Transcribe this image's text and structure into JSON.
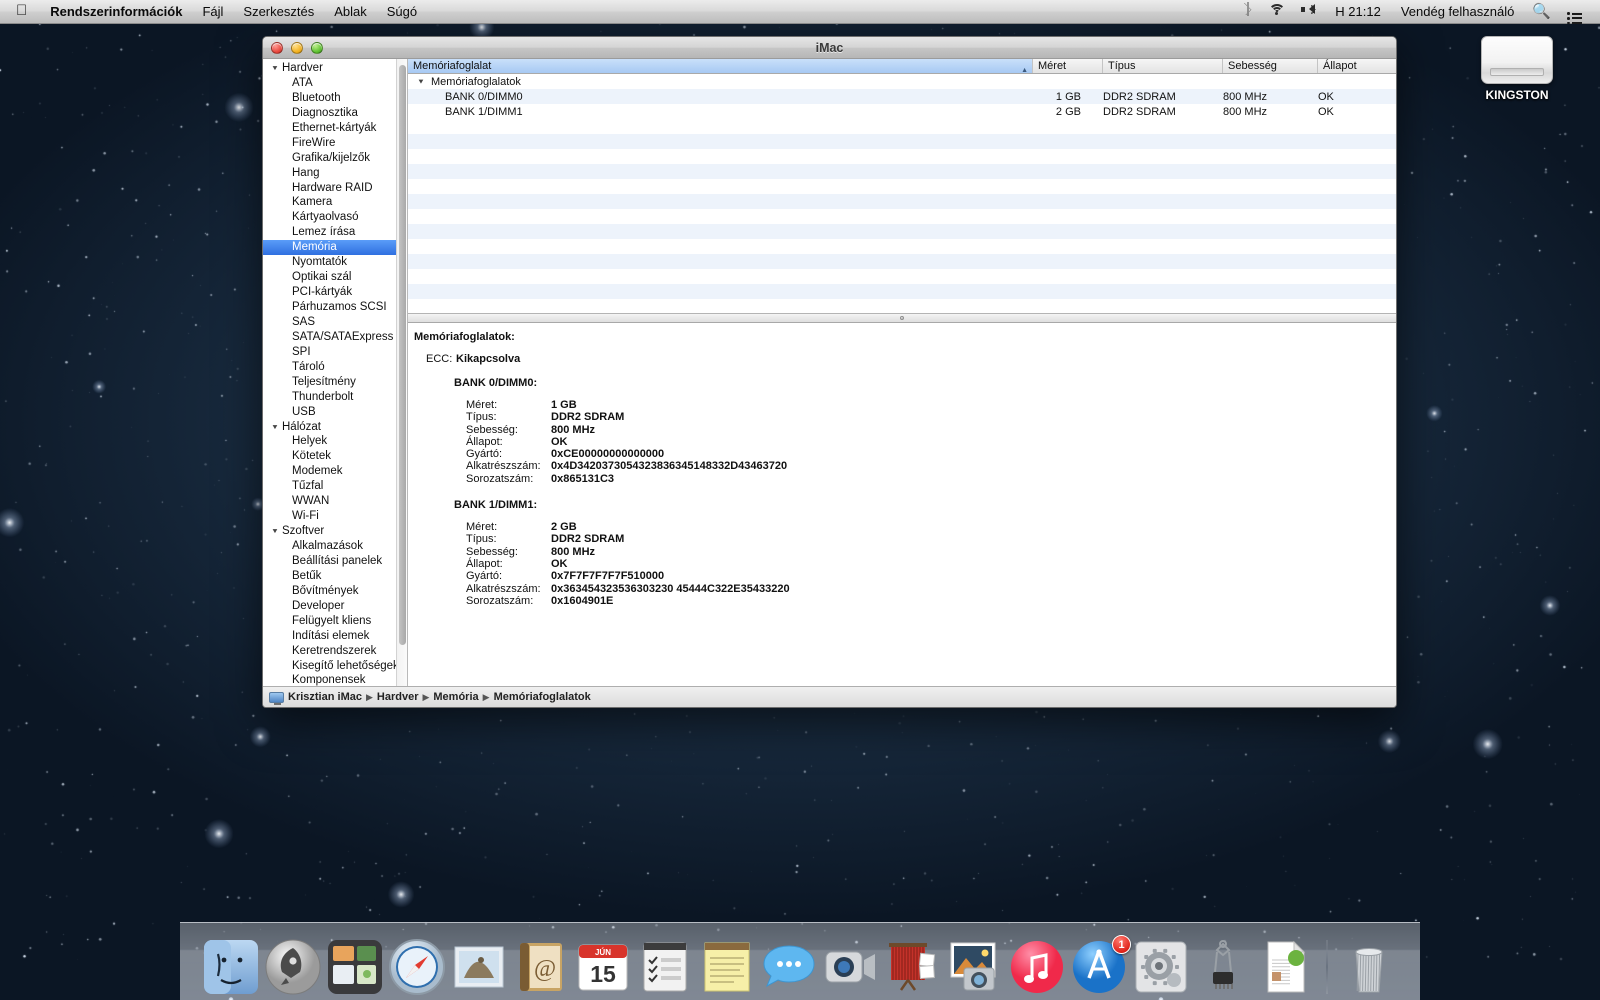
{
  "menubar": {
    "apple_icon": "apple-icon",
    "items": [
      "Rendszerinformációk",
      "Fájl",
      "Szerkesztés",
      "Ablak",
      "Súgó"
    ],
    "status": {
      "bluetooth_icon": "bluetooth-icon",
      "wifi_icon": "wifi-icon",
      "volume_icon": "volume-icon",
      "clock": "H 21:12",
      "user": "Vendég felhasználó",
      "search_icon": "spotlight-search-icon",
      "notification_icon": "notification-center-icon"
    }
  },
  "desktop": {
    "drive_label": "KINGSTON",
    "drive_icon": "external-drive-icon"
  },
  "window": {
    "title": "iMac",
    "close_label": "close",
    "minimize_label": "minimize",
    "zoom_label": "zoom"
  },
  "sidebar": {
    "items": [
      {
        "label": "Hardver",
        "level": 0,
        "expanded": true,
        "selected": false
      },
      {
        "label": "ATA",
        "level": 1,
        "selected": false
      },
      {
        "label": "Bluetooth",
        "level": 1,
        "selected": false
      },
      {
        "label": "Diagnosztika",
        "level": 1,
        "selected": false
      },
      {
        "label": "Ethernet-kártyák",
        "level": 1,
        "selected": false
      },
      {
        "label": "FireWire",
        "level": 1,
        "selected": false
      },
      {
        "label": "Grafika/kijelzők",
        "level": 1,
        "selected": false
      },
      {
        "label": "Hang",
        "level": 1,
        "selected": false
      },
      {
        "label": "Hardware RAID",
        "level": 1,
        "selected": false
      },
      {
        "label": "Kamera",
        "level": 1,
        "selected": false
      },
      {
        "label": "Kártyaolvasó",
        "level": 1,
        "selected": false
      },
      {
        "label": "Lemez írása",
        "level": 1,
        "selected": false
      },
      {
        "label": "Memória",
        "level": 1,
        "selected": true
      },
      {
        "label": "Nyomtatók",
        "level": 1,
        "selected": false
      },
      {
        "label": "Optikai szál",
        "level": 1,
        "selected": false
      },
      {
        "label": "PCI-kártyák",
        "level": 1,
        "selected": false
      },
      {
        "label": "Párhuzamos SCSI",
        "level": 1,
        "selected": false
      },
      {
        "label": "SAS",
        "level": 1,
        "selected": false
      },
      {
        "label": "SATA/SATAExpress",
        "level": 1,
        "selected": false
      },
      {
        "label": "SPI",
        "level": 1,
        "selected": false
      },
      {
        "label": "Tároló",
        "level": 1,
        "selected": false
      },
      {
        "label": "Teljesítmény",
        "level": 1,
        "selected": false
      },
      {
        "label": "Thunderbolt",
        "level": 1,
        "selected": false
      },
      {
        "label": "USB",
        "level": 1,
        "selected": false
      },
      {
        "label": "Hálózat",
        "level": 0,
        "expanded": true,
        "selected": false
      },
      {
        "label": "Helyek",
        "level": 1,
        "selected": false
      },
      {
        "label": "Kötetek",
        "level": 1,
        "selected": false
      },
      {
        "label": "Modemek",
        "level": 1,
        "selected": false
      },
      {
        "label": "Tűzfal",
        "level": 1,
        "selected": false
      },
      {
        "label": "WWAN",
        "level": 1,
        "selected": false
      },
      {
        "label": "Wi-Fi",
        "level": 1,
        "selected": false
      },
      {
        "label": "Szoftver",
        "level": 0,
        "expanded": true,
        "selected": false
      },
      {
        "label": "Alkalmazások",
        "level": 1,
        "selected": false
      },
      {
        "label": "Beállítási panelek",
        "level": 1,
        "selected": false
      },
      {
        "label": "Betűk",
        "level": 1,
        "selected": false
      },
      {
        "label": "Bővítmények",
        "level": 1,
        "selected": false
      },
      {
        "label": "Developer",
        "level": 1,
        "selected": false
      },
      {
        "label": "Felügyelt kliens",
        "level": 1,
        "selected": false
      },
      {
        "label": "Indítási elemek",
        "level": 1,
        "selected": false
      },
      {
        "label": "Keretrendszerek",
        "level": 1,
        "selected": false
      },
      {
        "label": "Kisegítő lehetőségek",
        "level": 1,
        "selected": false
      },
      {
        "label": "Komponensek",
        "level": 1,
        "selected": false
      }
    ],
    "disclosure_glyph": "▼"
  },
  "table": {
    "columns": [
      {
        "label": "Memóriafoglalat",
        "sorted": true,
        "sort_glyph": "▲"
      },
      {
        "label": "Méret",
        "sorted": false
      },
      {
        "label": "Típus",
        "sorted": false
      },
      {
        "label": "Sebesség",
        "sorted": false
      },
      {
        "label": "Állapot",
        "sorted": false
      }
    ],
    "group_row": {
      "label": "Memóriafoglalatok",
      "disclosure": "▼"
    },
    "rows": [
      {
        "name": "BANK 0/DIMM0",
        "size": "1 GB",
        "type": "DDR2 SDRAM",
        "speed": "800 MHz",
        "status": "OK"
      },
      {
        "name": "BANK 1/DIMM1",
        "size": "2 GB",
        "type": "DDR2 SDRAM",
        "speed": "800 MHz",
        "status": "OK"
      }
    ]
  },
  "detail": {
    "title": "Memóriafoglalatok:",
    "ecc_key": "ECC:",
    "ecc_value": "Kikapcsolva",
    "banks": [
      {
        "name": "BANK 0/DIMM0:",
        "fields": [
          {
            "key": "Méret:",
            "value": "1 GB"
          },
          {
            "key": "Típus:",
            "value": "DDR2 SDRAM"
          },
          {
            "key": "Sebesség:",
            "value": "800 MHz"
          },
          {
            "key": "Állapot:",
            "value": "OK"
          },
          {
            "key": "Gyártó:",
            "value": "0xCE00000000000000"
          },
          {
            "key": "Alkatrészszám:",
            "value": "0x4D3420373054323836345148332D43463720"
          },
          {
            "key": "Sorozatszám:",
            "value": "0x865131C3"
          }
        ]
      },
      {
        "name": "BANK 1/DIMM1:",
        "fields": [
          {
            "key": "Méret:",
            "value": "2 GB"
          },
          {
            "key": "Típus:",
            "value": "DDR2 SDRAM"
          },
          {
            "key": "Sebesség:",
            "value": "800 MHz"
          },
          {
            "key": "Állapot:",
            "value": "OK"
          },
          {
            "key": "Gyártó:",
            "value": "0x7F7F7F7F7F510000"
          },
          {
            "key": "Alkatrészszám:",
            "value": "0x363454323536303230 45444C322E35433220"
          },
          {
            "key": "Sorozatszám:",
            "value": "0x1604901E"
          }
        ]
      }
    ]
  },
  "breadcrumb": {
    "icon": "computer-icon",
    "separator": "▶",
    "items": [
      "Krisztian iMac",
      "Hardver",
      "Memória",
      "Memóriafoglalatok"
    ]
  },
  "dock": {
    "items": [
      {
        "name": "finder",
        "label": "Finder"
      },
      {
        "name": "launchpad",
        "label": "Launchpad"
      },
      {
        "name": "mission-control",
        "label": "Mission Control"
      },
      {
        "name": "safari",
        "label": "Safari"
      },
      {
        "name": "mail",
        "label": "Mail"
      },
      {
        "name": "contacts",
        "label": "Névjegyek"
      },
      {
        "name": "calendar",
        "label": "Naptár",
        "month": "JÚN",
        "day": "15"
      },
      {
        "name": "reminders",
        "label": "Emlékeztetők"
      },
      {
        "name": "notes",
        "label": "Jegyzetek"
      },
      {
        "name": "messages",
        "label": "Üzenetek"
      },
      {
        "name": "facetime",
        "label": "FaceTime"
      },
      {
        "name": "photo-booth",
        "label": "Photo Booth"
      },
      {
        "name": "iphoto",
        "label": "iPhoto"
      },
      {
        "name": "itunes",
        "label": "iTunes"
      },
      {
        "name": "app-store",
        "label": "App Store",
        "badge": "1"
      },
      {
        "name": "system-preferences",
        "label": "Rendszerbeállítások"
      },
      {
        "name": "xcode",
        "label": "Xcode"
      },
      {
        "name": "document",
        "label": "Dokumentum"
      },
      {
        "name": "trash",
        "label": "Kuka"
      }
    ]
  }
}
